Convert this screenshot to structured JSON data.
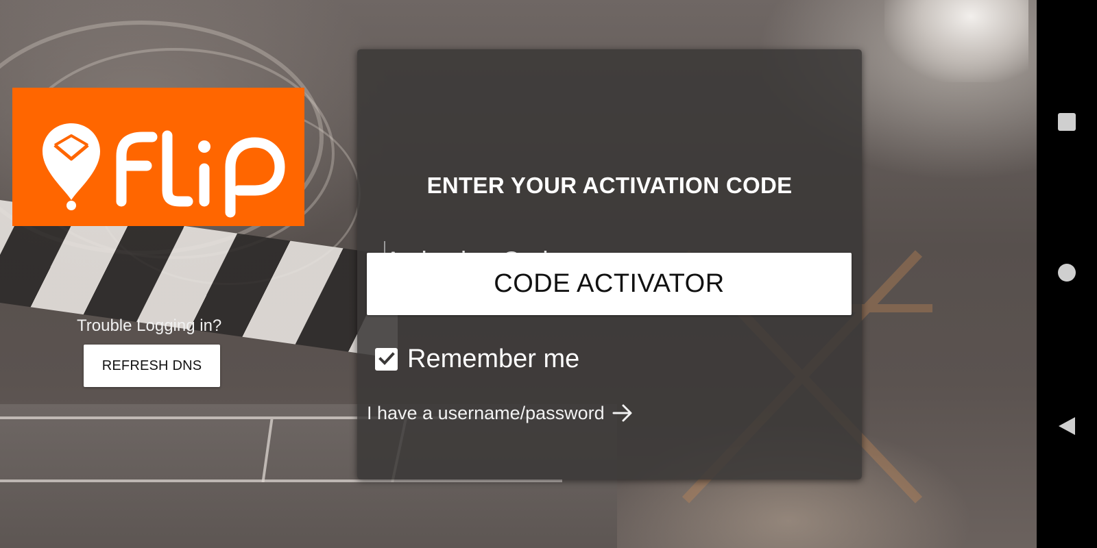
{
  "logo": {
    "text": "FLIP",
    "background_color": "#ff6600",
    "icon": "envelope-pin-icon"
  },
  "left_panel": {
    "trouble_text": "Trouble Logging in?",
    "refresh_label": "REFRESH DNS"
  },
  "card": {
    "title": "ENTER YOUR ACTIVATION CODE",
    "input_placeholder": "Activation Code",
    "input_value": "",
    "activate_label": "CODE ACTIVATOR",
    "remember_label": "Remember me",
    "remember_checked": true,
    "alt_login_label": "I have a username/password",
    "alt_login_icon": "arrow-right-icon",
    "accent_color": "#e8397c"
  },
  "navbar": {
    "buttons": [
      {
        "icon": "recents-square-icon"
      },
      {
        "icon": "home-circle-icon"
      },
      {
        "icon": "back-triangle-icon"
      }
    ]
  }
}
